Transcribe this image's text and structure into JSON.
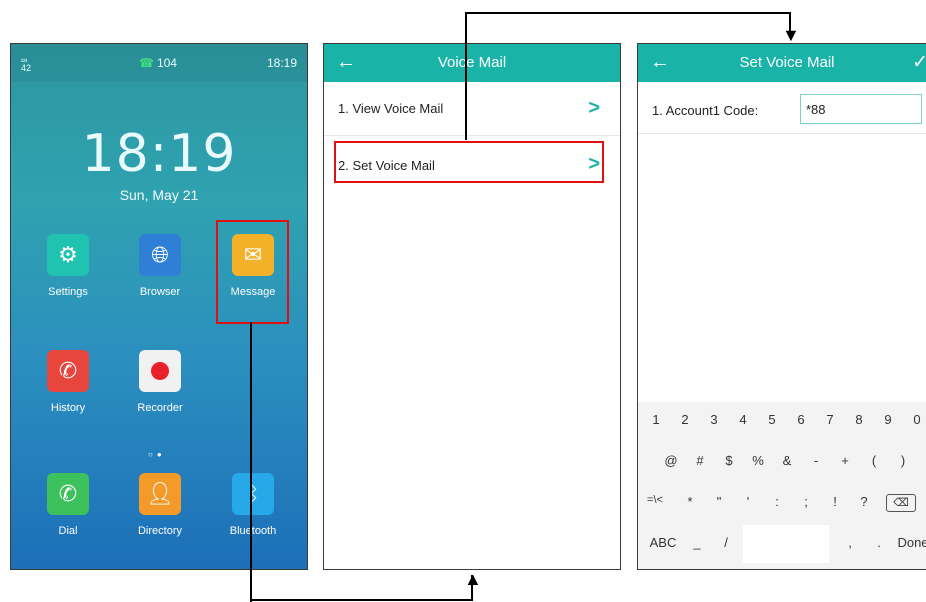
{
  "home": {
    "status": {
      "signal": "42",
      "call_label": "104",
      "time": "18:19"
    },
    "clock": "18:19",
    "date": "Sun, May 21",
    "apps": [
      {
        "label": "Settings",
        "icon": "gear-icon",
        "color": "#1fc3b0"
      },
      {
        "label": "Browser",
        "icon": "globe-icon",
        "color": "#2f7fd6"
      },
      {
        "label": "Message",
        "icon": "envelope-icon",
        "color": "#f3b12a"
      },
      {
        "label": "History",
        "icon": "missed-call-icon",
        "color": "#e8453c"
      },
      {
        "label": "Recorder",
        "icon": "record-icon",
        "color": "#f1f1f1"
      },
      {
        "label": "Dial",
        "icon": "phone-icon",
        "color": "#3cc15c"
      },
      {
        "label": "Directory",
        "icon": "contact-icon",
        "color": "#f39a2a"
      },
      {
        "label": "Bluetooth",
        "icon": "bluetooth-icon",
        "color": "#27a8e8"
      }
    ]
  },
  "voicemail": {
    "title": "Voice Mail",
    "items": [
      {
        "label": "1. View Voice Mail"
      },
      {
        "label": "2. Set Voice Mail"
      }
    ]
  },
  "setvoicemail": {
    "title": "Set Voice Mail",
    "field_label": "1. Account1 Code:",
    "field_value": "*88",
    "keyboard": {
      "row1": [
        "1",
        "2",
        "3",
        "4",
        "5",
        "6",
        "7",
        "8",
        "9",
        "0"
      ],
      "row2": [
        "@",
        "#",
        "$",
        "%",
        "&",
        "-",
        "+",
        "(",
        ")"
      ],
      "row3": [
        "=\\<",
        "*",
        "\"",
        "'",
        ":",
        ";",
        "!",
        "?"
      ],
      "row4": [
        "ABC",
        "_",
        "/",
        ",",
        ".",
        "Done"
      ]
    }
  },
  "colors": {
    "accent": "#19b3a8",
    "highlight": "#e01010"
  }
}
